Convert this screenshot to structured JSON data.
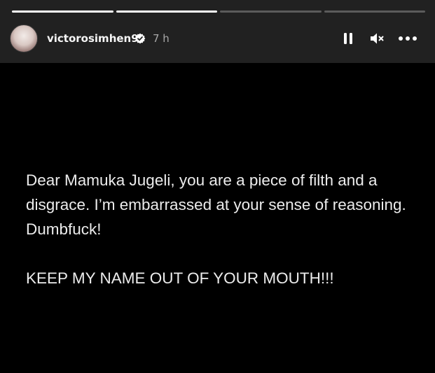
{
  "header": {
    "username": "victorosimhen9",
    "time": "7 h",
    "progress": [
      1,
      1,
      0,
      0
    ]
  },
  "icons": {
    "verified": "verified-badge-icon",
    "pause": "pause-icon",
    "mute": "speaker-muted-icon",
    "more": "more-options-icon"
  },
  "story": {
    "message": "Dear Mamuka Jugeli, you are a piece of filth and a disgrace. I’m embarrassed at your sense of reasoning. Dumbfuck!",
    "shout": "KEEP MY NAME OUT OF YOUR MOUTH!!!"
  },
  "colors": {
    "header_bg": "#212121",
    "background": "#000000",
    "text": "#ececec"
  }
}
